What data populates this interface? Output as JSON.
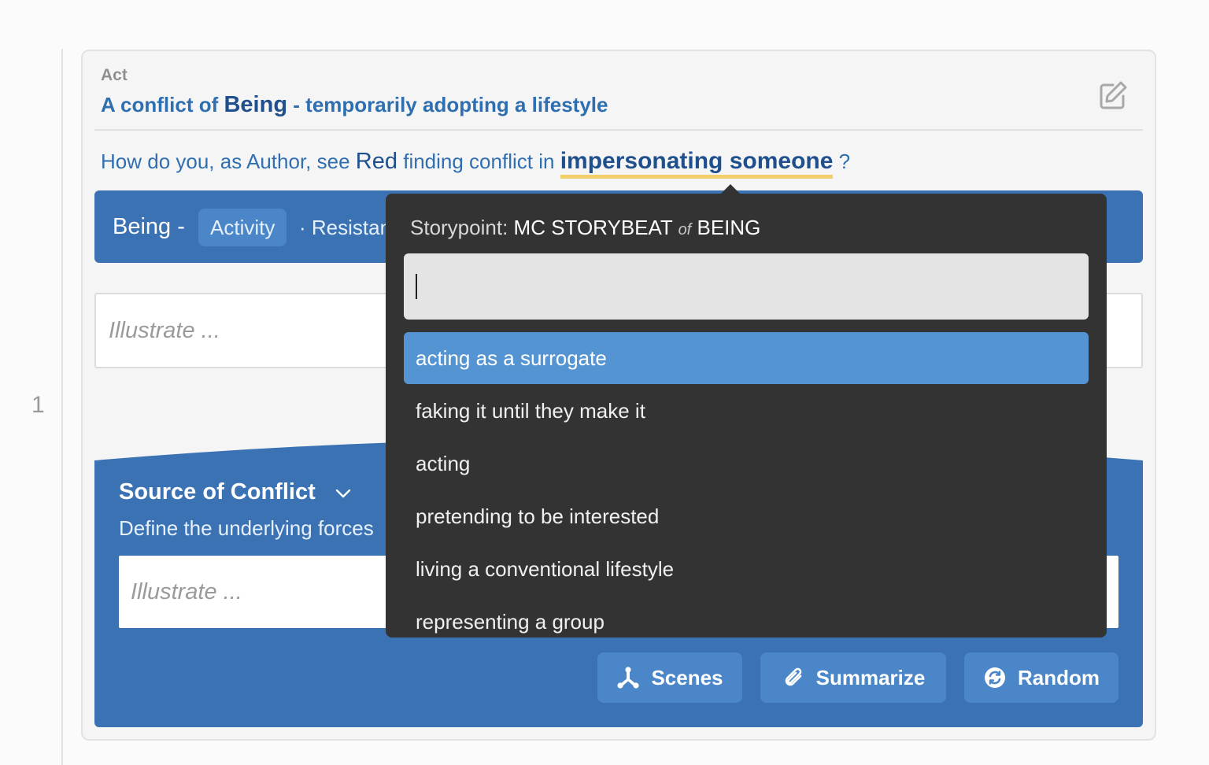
{
  "gutter": {
    "line_number": "1"
  },
  "act": {
    "label": "Act",
    "title_prefix": "A conflict of",
    "title_emph": "Being",
    "title_suffix": "- temporarily adopting a lifestyle"
  },
  "question": {
    "part1": "How do you, as Author, see",
    "character": "Red",
    "part2": "finding conflict in",
    "storybeat": "impersonating someone",
    "part3": "?"
  },
  "bar": {
    "title": "Being -",
    "pill": "Activity",
    "extra": "· Resistance"
  },
  "illustrate_top": {
    "placeholder": "Illustrate ..."
  },
  "source": {
    "title": "Source of Conflict",
    "subtitle": "Define the underlying forces",
    "placeholder": "Illustrate ..."
  },
  "buttons": {
    "scenes": "Scenes",
    "summarize": "Summarize",
    "random": "Random"
  },
  "popover": {
    "prefix": "Storypoint:",
    "main": "MC STORYBEAT",
    "of": "of",
    "domain": "BEING",
    "input_value": "",
    "options": [
      "acting as a surrogate",
      "faking it until they make it",
      "acting",
      "pretending to be interested",
      "living a conventional lifestyle",
      "representing a group"
    ]
  },
  "colors": {
    "primary_blue": "#3a72b3",
    "accent_blue": "#4a86c8",
    "selected_option": "#5494d3",
    "popover_bg": "#333333",
    "underline": "#f1cf6a"
  }
}
